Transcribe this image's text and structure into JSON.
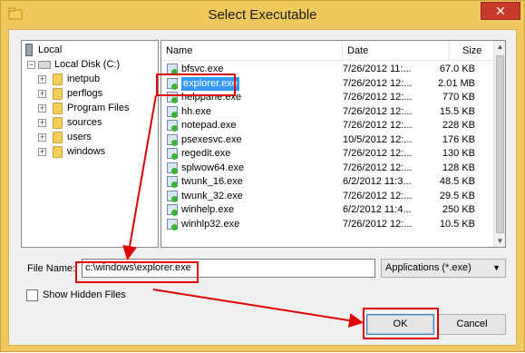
{
  "window": {
    "title": "Select Executable",
    "close_glyph": "✕"
  },
  "tree": {
    "items": [
      {
        "label": "Local",
        "icon": "computer-icon"
      },
      {
        "label": "Local Disk (C:)",
        "icon": "drive-icon"
      },
      {
        "label": "inetpub",
        "icon": "folder-icon"
      },
      {
        "label": "perflogs",
        "icon": "folder-icon"
      },
      {
        "label": "Program Files",
        "icon": "folder-icon"
      },
      {
        "label": "sources",
        "icon": "folder-icon"
      },
      {
        "label": "users",
        "icon": "folder-icon"
      },
      {
        "label": "windows",
        "icon": "folder-icon"
      }
    ],
    "expander_glyph": "+",
    "collapse_glyph": "−"
  },
  "list": {
    "columns": {
      "name": "Name",
      "date": "Date",
      "size": "Size"
    },
    "files": [
      {
        "name": "bfsvc.exe",
        "date": "7/26/2012 11:...",
        "size": "67.0 KB"
      },
      {
        "name": "explorer.exe",
        "date": "7/26/2012 12:...",
        "size": "2.01 MB"
      },
      {
        "name": "helppane.exe",
        "date": "7/26/2012 12:...",
        "size": "770 KB"
      },
      {
        "name": "hh.exe",
        "date": "7/26/2012 12:...",
        "size": "15.5 KB"
      },
      {
        "name": "notepad.exe",
        "date": "7/26/2012 12:...",
        "size": "228 KB"
      },
      {
        "name": "psexesvc.exe",
        "date": "10/5/2012 12:...",
        "size": "176 KB"
      },
      {
        "name": "regedit.exe",
        "date": "7/26/2012 12:...",
        "size": "130 KB"
      },
      {
        "name": "splwow64.exe",
        "date": "7/26/2012 12:...",
        "size": "128 KB"
      },
      {
        "name": "twunk_16.exe",
        "date": "6/2/2012 11:3...",
        "size": "48.5 KB"
      },
      {
        "name": "twunk_32.exe",
        "date": "7/26/2012 12:...",
        "size": "29.5 KB"
      },
      {
        "name": "winhelp.exe",
        "date": "6/2/2012 11:4...",
        "size": "250 KB"
      },
      {
        "name": "winhlp32.exe",
        "date": "7/26/2012 12:...",
        "size": "10.5 KB"
      }
    ],
    "selected_index": 1
  },
  "file_name": {
    "label": "File Name:",
    "value": "c:\\windows\\explorer.exe"
  },
  "filter": {
    "value": "Applications (*.exe)",
    "arrow": "▼"
  },
  "show_hidden": {
    "label": "Show Hidden Files",
    "checked": false
  },
  "buttons": {
    "ok": "OK",
    "cancel": "Cancel"
  },
  "scroll": {
    "up": "▲",
    "down": "▼"
  },
  "annotation_color": "#e00000"
}
